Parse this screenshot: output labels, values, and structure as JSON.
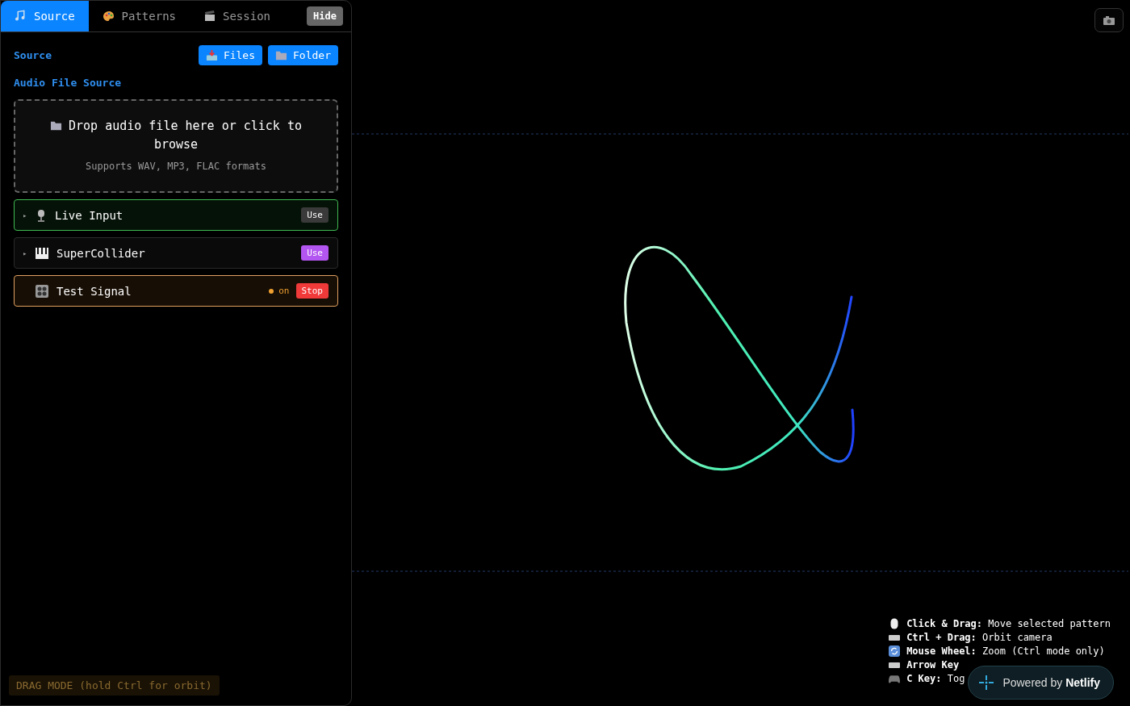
{
  "tabs": [
    {
      "label": "Source",
      "selected": true
    },
    {
      "label": "Patterns",
      "selected": false
    },
    {
      "label": "Session",
      "selected": false
    }
  ],
  "hide_button": "Hide",
  "section_title": "Source",
  "header_buttons": [
    {
      "label": "Files"
    },
    {
      "label": "Folder"
    }
  ],
  "subsection_title": "Audio File Source",
  "drop_zone": {
    "text": "Drop audio file here or click to browse",
    "hint": "Supports WAV, MP3, FLAC formats"
  },
  "sources": [
    {
      "kind": "live",
      "toggle": "▸",
      "label": "Live Input",
      "action": "Use"
    },
    {
      "kind": "supercollider",
      "toggle": "▸",
      "label": "SuperCollider",
      "action": "Use"
    },
    {
      "kind": "test",
      "label": "Test Signal",
      "status": "on",
      "action": "Stop"
    }
  ],
  "mode_banner": "DRAG MODE (hold Ctrl for orbit)",
  "help": [
    {
      "key": "Click & Drag:",
      "text": "Move selected pattern"
    },
    {
      "key": "Ctrl + Drag:",
      "text": "Orbit camera"
    },
    {
      "key": "Mouse Wheel:",
      "text": "Zoom (Ctrl mode only)"
    },
    {
      "key": "Arrow Key"
    },
    {
      "key": "C Key:",
      "text": "Tog"
    }
  ],
  "badge": {
    "prefix": "Powered by",
    "brand": "Netlify"
  }
}
